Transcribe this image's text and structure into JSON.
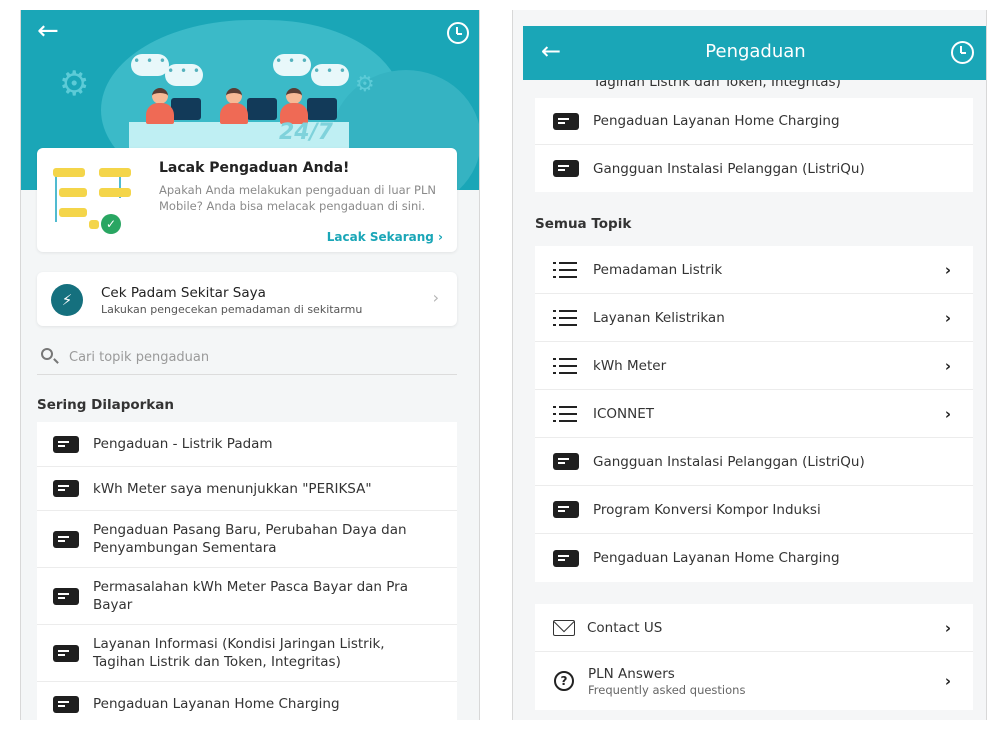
{
  "left": {
    "track_card": {
      "title": "Lacak Pengaduan Anda!",
      "description": "Apakah Anda melakukan pengaduan di luar PLN Mobile? Anda bisa melacak pengaduan di sini.",
      "link": "Lacak Sekarang ›"
    },
    "hero": {
      "badge": "24/7",
      "bubble": "• • •"
    },
    "cek_padam": {
      "title": "Cek Padam Sekitar Saya",
      "subtitle": "Lakukan pengecekan pemadaman di sekitarmu",
      "chevron": "›"
    },
    "search": {
      "placeholder": "Cari topik pengaduan",
      "value": ""
    },
    "sering_title": "Sering Dilaporkan",
    "sering_items": [
      {
        "label": "Pengaduan - Listrik Padam"
      },
      {
        "label": "kWh Meter saya menunjukkan \"PERIKSA\""
      },
      {
        "label": "Pengaduan Pasang Baru, Perubahan Daya dan Penyambungan Sementara"
      },
      {
        "label": "Permasalahan kWh Meter Pasca Bayar dan Pra Bayar"
      },
      {
        "label": "Layanan Informasi (Kondisi Jaringan Listrik, Tagihan Listrik dan Token, Integritas)"
      },
      {
        "label": "Pengaduan Layanan Home Charging"
      }
    ],
    "back_icon": "←"
  },
  "right": {
    "header": {
      "title": "Pengaduan",
      "back_icon": "←"
    },
    "cut_off_text": "Tagihan Listrik dan Token, Integritas)",
    "top_items": [
      {
        "label": "Pengaduan Layanan Home Charging"
      },
      {
        "label": "Gangguan Instalasi Pelanggan (ListriQu)"
      }
    ],
    "semua_title": "Semua Topik",
    "semua_items": [
      {
        "label": "Pemadaman Listrik",
        "icon": "list-icon",
        "chevron": "›"
      },
      {
        "label": "Layanan Kelistrikan",
        "icon": "list-icon",
        "chevron": "›"
      },
      {
        "label": "kWh Meter",
        "icon": "list-icon",
        "chevron": "›"
      },
      {
        "label": "ICONNET",
        "icon": "list-icon",
        "chevron": "›"
      },
      {
        "label": "Gangguan Instalasi Pelanggan (ListriQu)",
        "icon": "card-icon"
      },
      {
        "label": "Program Konversi Kompor Induksi",
        "icon": "card-icon"
      },
      {
        "label": "Pengaduan Layanan Home Charging",
        "icon": "card-icon"
      }
    ],
    "contact": {
      "label": "Contact US",
      "chevron": "›"
    },
    "answers": {
      "label": "PLN Answers",
      "subtitle": "Frequently asked questions",
      "chevron": "›"
    }
  },
  "colors": {
    "brand": "#1aa6b7",
    "accent_link": "#1aa6b7",
    "check": "#29a662"
  }
}
